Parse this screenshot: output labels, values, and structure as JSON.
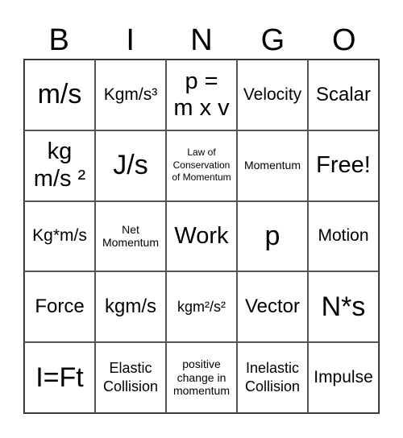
{
  "header": [
    "B",
    "I",
    "N",
    "G",
    "O"
  ],
  "cells": [
    {
      "text": "m/s",
      "size": "s-xl"
    },
    {
      "text": "Kgm/s³",
      "size": "s-ms"
    },
    {
      "text": "p =\nm x v",
      "size": "s-l"
    },
    {
      "text": "Velocity",
      "size": "s-ms"
    },
    {
      "text": "Scalar",
      "size": "s-m"
    },
    {
      "text": "kg\nm/s ²",
      "size": "s-l"
    },
    {
      "text": "J/s",
      "size": "s-xl"
    },
    {
      "text": "Law of\nConservation\nof Momentum",
      "size": "s-xxs"
    },
    {
      "text": "Momentum",
      "size": "s-xs"
    },
    {
      "text": "Free!",
      "size": "s-l"
    },
    {
      "text": "Kg*m/s",
      "size": "s-ms"
    },
    {
      "text": "Net\nMomentum",
      "size": "s-xs"
    },
    {
      "text": "Work",
      "size": "s-l"
    },
    {
      "text": "p",
      "size": "s-xl"
    },
    {
      "text": "Motion",
      "size": "s-ms"
    },
    {
      "text": "Force",
      "size": "s-m"
    },
    {
      "text": "kgm/s",
      "size": "s-m"
    },
    {
      "text": "kgm²/s²",
      "size": "s-s"
    },
    {
      "text": "Vector",
      "size": "s-m"
    },
    {
      "text": "N*s",
      "size": "s-xl"
    },
    {
      "text": "I=Ft",
      "size": "s-xl"
    },
    {
      "text": "Elastic\nCollision",
      "size": "s-s"
    },
    {
      "text": "positive\nchange in\nmomentum",
      "size": "s-xs"
    },
    {
      "text": "Inelastic\nCollision",
      "size": "s-s"
    },
    {
      "text": "Impulse",
      "size": "s-ms"
    }
  ]
}
